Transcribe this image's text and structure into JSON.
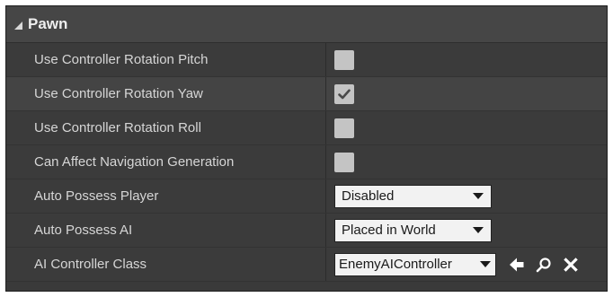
{
  "section": {
    "title": "Pawn",
    "expanded": true
  },
  "properties": [
    {
      "label": "Use Controller Rotation Pitch",
      "type": "checkbox",
      "checked": false
    },
    {
      "label": "Use Controller Rotation Yaw",
      "type": "checkbox",
      "checked": true
    },
    {
      "label": "Use Controller Rotation Roll",
      "type": "checkbox",
      "checked": false
    },
    {
      "label": "Can Affect Navigation Generation",
      "type": "checkbox",
      "checked": false
    },
    {
      "label": "Auto Possess Player",
      "type": "dropdown",
      "value": "Disabled"
    },
    {
      "label": "Auto Possess AI",
      "type": "dropdown",
      "value": "Placed in World"
    },
    {
      "label": "AI Controller Class",
      "type": "class-picker",
      "value": "EnemyAIController",
      "actions": [
        "arrow-left-icon",
        "search-icon",
        "close-icon"
      ]
    }
  ],
  "colors": {
    "panel_bg": "#3a3a3a",
    "row_alt_bg": "#444444",
    "header_bg": "#464646",
    "label_text": "#d6d6d6",
    "checkbox_bg": "#c4c4c4",
    "combo_bg": "#f2f2f2"
  }
}
